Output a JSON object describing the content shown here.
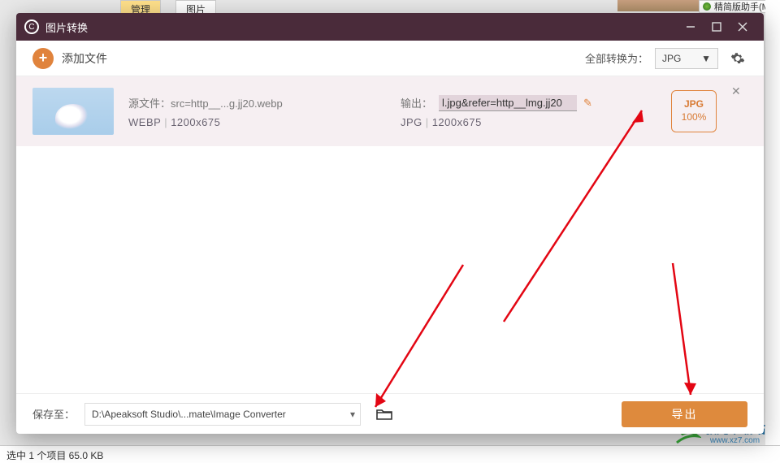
{
  "background": {
    "tab_yellow": "管理",
    "tab_plain": "图片",
    "helper_label": "精简版助手(M",
    "statusbar": "选中 1 个项目   65.0 KB"
  },
  "watermark": {
    "line1": "极光下载站",
    "line2": "www.xz7.com"
  },
  "titlebar": {
    "app_name": "图片转换"
  },
  "toolbar": {
    "add_label": "添加文件",
    "convert_all_label": "全部转换为：",
    "format_selected": "JPG"
  },
  "file": {
    "source_label": "源文件：",
    "source_name": "src=http__...g.jj20.webp",
    "source_fmt": "WEBP",
    "source_dim": "1200x675",
    "output_label": "输出：",
    "output_name": "l.jpg&refer=http__lmg.jj20",
    "output_fmt": "JPG",
    "output_dim": "1200x675",
    "badge_fmt": "JPG",
    "badge_quality": "100%"
  },
  "bottom": {
    "save_to_label": "保存至：",
    "path": "D:\\Apeaksoft Studio\\...mate\\Image Converter",
    "export_label": "导出"
  }
}
